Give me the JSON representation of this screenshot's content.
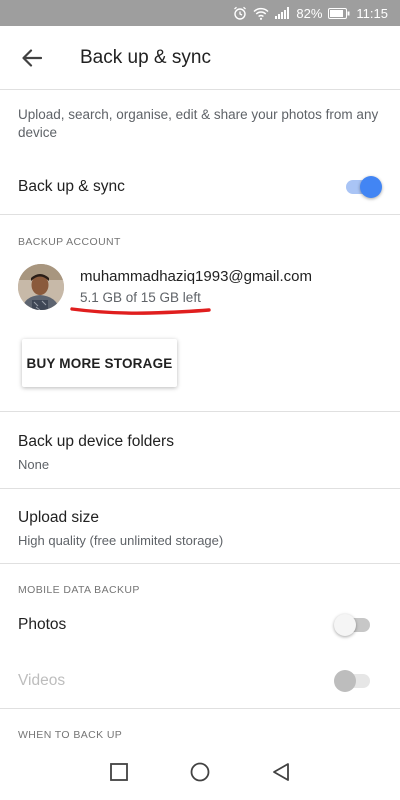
{
  "status_bar": {
    "battery": "82%",
    "time": "11:15"
  },
  "app_bar": {
    "title": "Back up & sync"
  },
  "description": "Upload, search, organise, edit & share your photos from any device",
  "backup_sync": {
    "label": "Back up & sync",
    "enabled": true
  },
  "backup_account": {
    "header": "BACKUP ACCOUNT",
    "email": "muhammadhaziq1993@gmail.com",
    "storage": "5.1 GB of 15 GB left",
    "buy_button": "BUY MORE STORAGE"
  },
  "device_folders": {
    "label": "Back up device folders",
    "value": "None"
  },
  "upload_size": {
    "label": "Upload size",
    "value": "High quality (free unlimited storage)"
  },
  "mobile_data": {
    "header": "MOBILE DATA BACKUP",
    "photos_label": "Photos",
    "photos_enabled": false,
    "videos_label": "Videos",
    "videos_enabled": false
  },
  "when_to_backup": {
    "header": "WHEN TO BACK UP"
  },
  "colors": {
    "accent": "#4285f4",
    "annotation_red": "#e01e1e",
    "status_bar": "#9e9e9e"
  },
  "icons": {
    "back": "arrow-left-icon",
    "alarm": "alarm-icon",
    "wifi": "wifi-icon",
    "signal": "signal-icon",
    "battery": "battery-icon",
    "nav_recents": "square-icon",
    "nav_home": "circle-icon",
    "nav_back": "triangle-icon"
  }
}
